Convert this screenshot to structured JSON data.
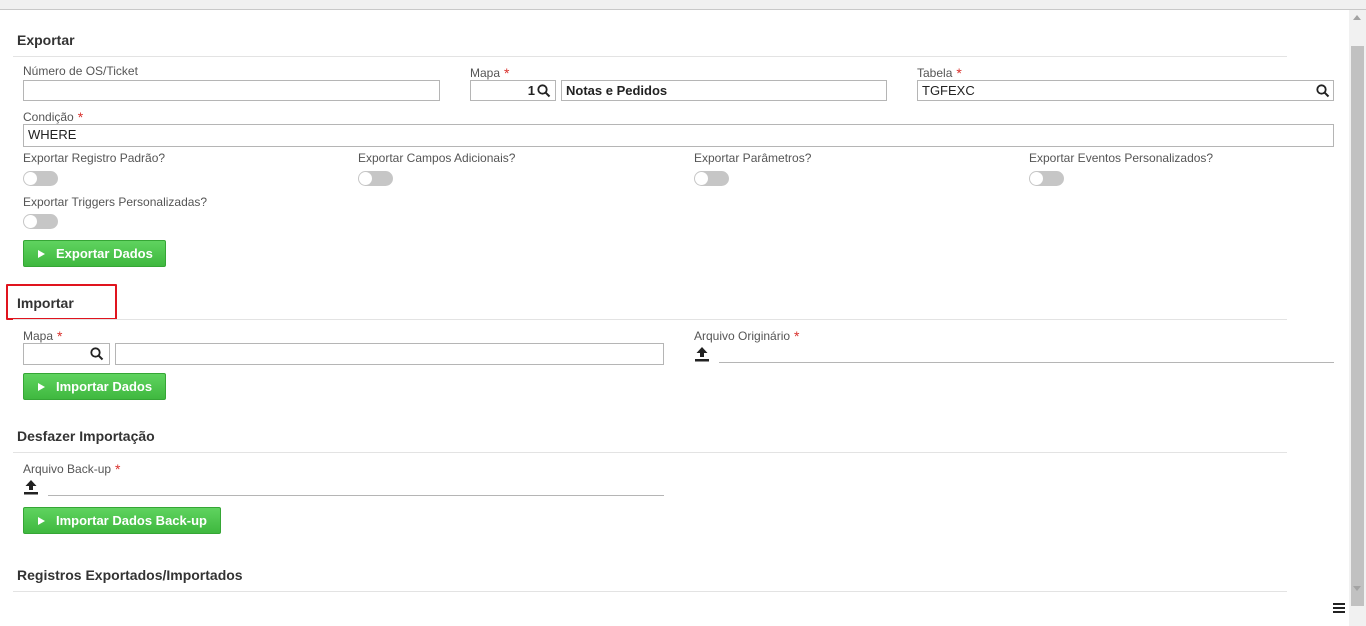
{
  "exportar": {
    "title": "Exportar",
    "numero_os_label": "Número de OS/Ticket",
    "numero_os_value": "",
    "mapa_label": "Mapa",
    "mapa_code": "1",
    "mapa_name": "Notas e Pedidos",
    "tabela_label": "Tabela",
    "tabela_value": "TGFEXC",
    "condicao_label": "Condição",
    "condicao_value": "WHERE",
    "toggles": [
      {
        "label": "Exportar Registro Padrão?",
        "value": false
      },
      {
        "label": "Exportar Campos Adicionais?",
        "value": false
      },
      {
        "label": "Exportar Parâmetros?",
        "value": false
      },
      {
        "label": "Exportar Eventos Personalizados?",
        "value": false
      },
      {
        "label": "Exportar Triggers Personalizadas?",
        "value": false
      }
    ],
    "button_label": "Exportar Dados"
  },
  "importar": {
    "title": "Importar",
    "mapa_label": "Mapa",
    "mapa_code": "",
    "mapa_name": "",
    "arquivo_label": "Arquivo Originário",
    "button_label": "Importar Dados"
  },
  "desfazer": {
    "title": "Desfazer Importação",
    "arquivo_label": "Arquivo Back-up",
    "button_label": "Importar Dados Back-up"
  },
  "registros": {
    "title": "Registros Exportados/Importados"
  },
  "required_marker": "*",
  "colors": {
    "required": "#d9302c",
    "button": "#4cc24c",
    "highlight": "#e0141e"
  },
  "icons": [
    "search-icon",
    "upload-icon",
    "play-icon",
    "menu-icon"
  ]
}
